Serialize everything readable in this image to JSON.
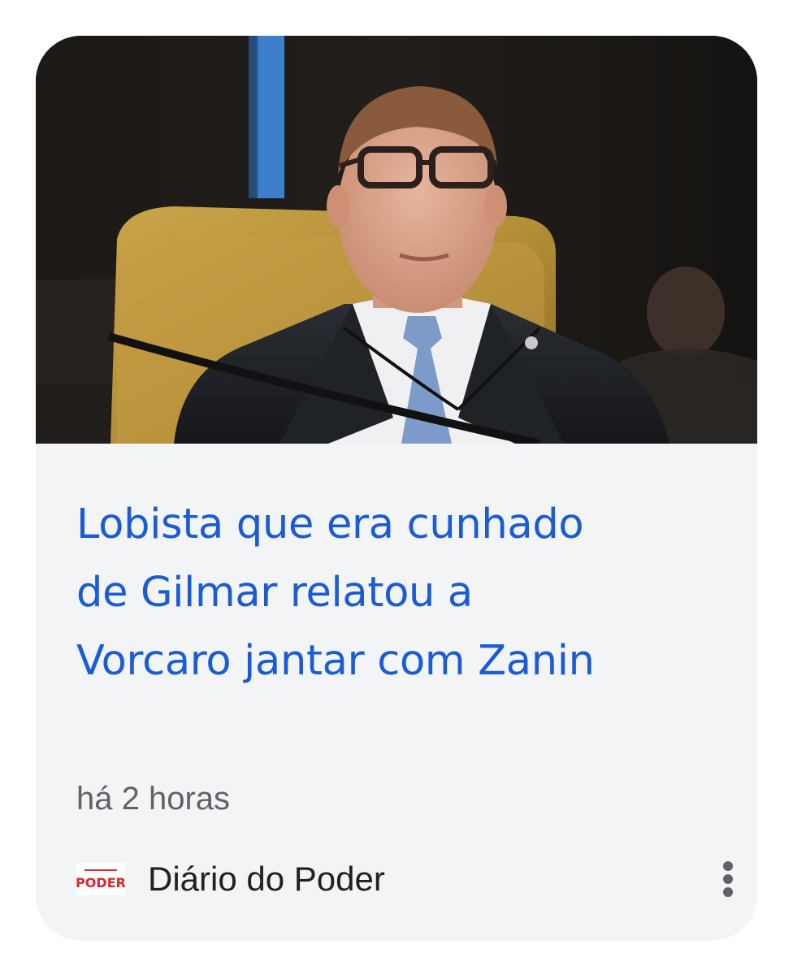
{
  "article": {
    "image_alt": "Foto",
    "headline_lines": [
      "Lobista que era cunhado",
      "de Gilmar relatou a",
      "Vorcaro jantar com Zanin"
    ],
    "time_ago": "há 2 horas",
    "source_name": "Diário do Poder",
    "source_logo_text": "PODER"
  },
  "colors": {
    "headline": "#1a5bd6",
    "card_background": "#f3f4f6",
    "meta_text": "#5f6368",
    "logo_red": "#d7262e"
  },
  "icons": {
    "menu": "more-vert-icon"
  }
}
